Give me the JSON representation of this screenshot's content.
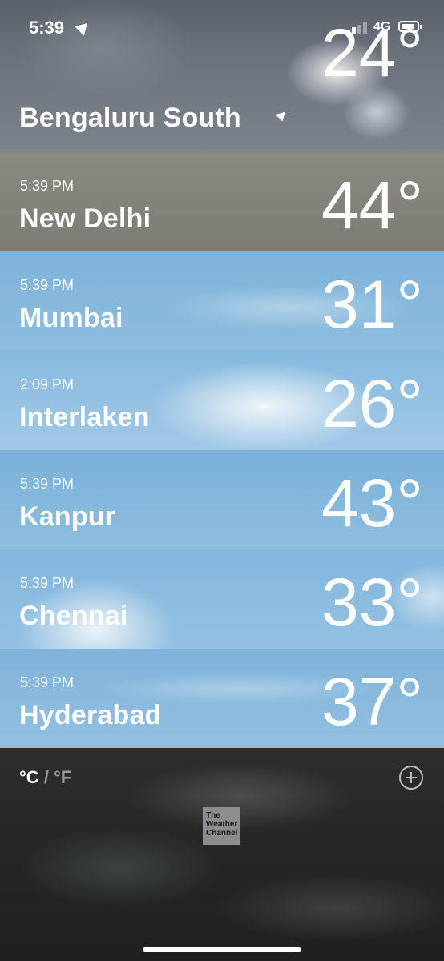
{
  "status_bar": {
    "time": "5:39",
    "network": "4G"
  },
  "current": {
    "city": "Bengaluru South",
    "temp": "24°"
  },
  "cities": [
    {
      "time": "5:39 PM",
      "city": "New Delhi",
      "temp": "44°"
    },
    {
      "time": "5:39 PM",
      "city": "Mumbai",
      "temp": "31°"
    },
    {
      "time": "2:09 PM",
      "city": "Interlaken",
      "temp": "26°"
    },
    {
      "time": "5:39 PM",
      "city": "Kanpur",
      "temp": "43°"
    },
    {
      "time": "5:39 PM",
      "city": "Chennai",
      "temp": "33°"
    },
    {
      "time": "5:39 PM",
      "city": "Hyderabad",
      "temp": "37°"
    }
  ],
  "footer": {
    "celsius": "°C",
    "separator": "/",
    "fahrenheit": "°F",
    "logo_text": "The Weather Channel"
  },
  "icons": [
    "location-arrow-icon",
    "signal-icon",
    "battery-icon",
    "add-circle-icon",
    "weather-channel-logo"
  ]
}
